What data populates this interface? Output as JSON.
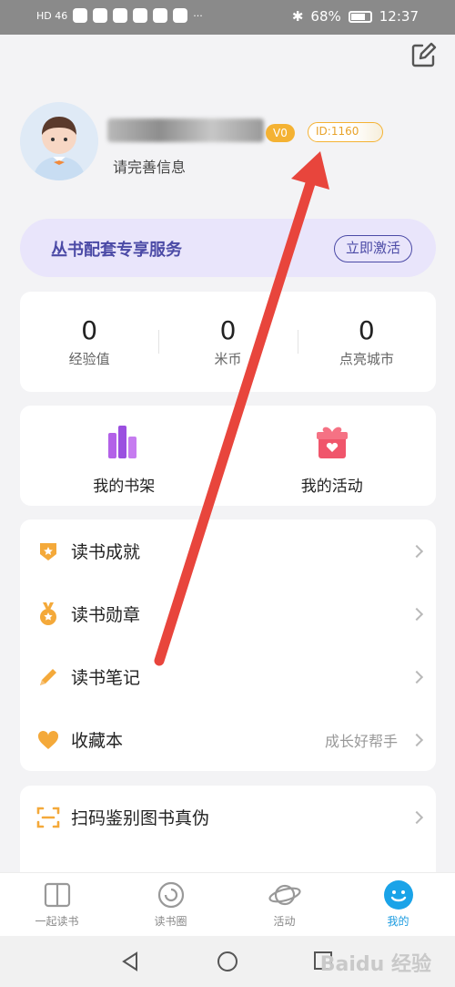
{
  "status_bar": {
    "left_text": "HD 46",
    "battery": "68%",
    "time": "12:37",
    "more": "···"
  },
  "header": {
    "edit_icon": "edit-icon"
  },
  "profile": {
    "level_badge": "V0",
    "id_text": "ID:1160",
    "complete_info": "请完善信息"
  },
  "service": {
    "title": "丛书配套专享服务",
    "activate_label": "立即激活",
    "accent": "#4b4aa6"
  },
  "stats": [
    {
      "value": "0",
      "label": "经验值"
    },
    {
      "value": "0",
      "label": "米币"
    },
    {
      "value": "0",
      "label": "点亮城市"
    }
  ],
  "quick": [
    {
      "label": "我的书架",
      "icon": "bookshelf-icon"
    },
    {
      "label": "我的活动",
      "icon": "gift-icon"
    }
  ],
  "menu": [
    {
      "label": "读书成就",
      "icon": "shield-star-icon",
      "extra": ""
    },
    {
      "label": "读书勋章",
      "icon": "medal-icon",
      "extra": ""
    },
    {
      "label": "读书笔记",
      "icon": "pencil-icon",
      "extra": ""
    },
    {
      "label": "收藏本",
      "icon": "heart-icon",
      "extra": "成长好帮手"
    }
  ],
  "menu2": [
    {
      "label": "扫码鉴别图书真伪",
      "icon": "scan-icon"
    }
  ],
  "tabs": [
    {
      "label": "一起读书",
      "icon": "book-icon",
      "active": false
    },
    {
      "label": "读书圈",
      "icon": "circle-icon",
      "active": false
    },
    {
      "label": "活动",
      "icon": "planet-icon",
      "active": false
    },
    {
      "label": "我的",
      "icon": "face-icon",
      "active": true
    }
  ],
  "watermark": "Baidu 经验"
}
